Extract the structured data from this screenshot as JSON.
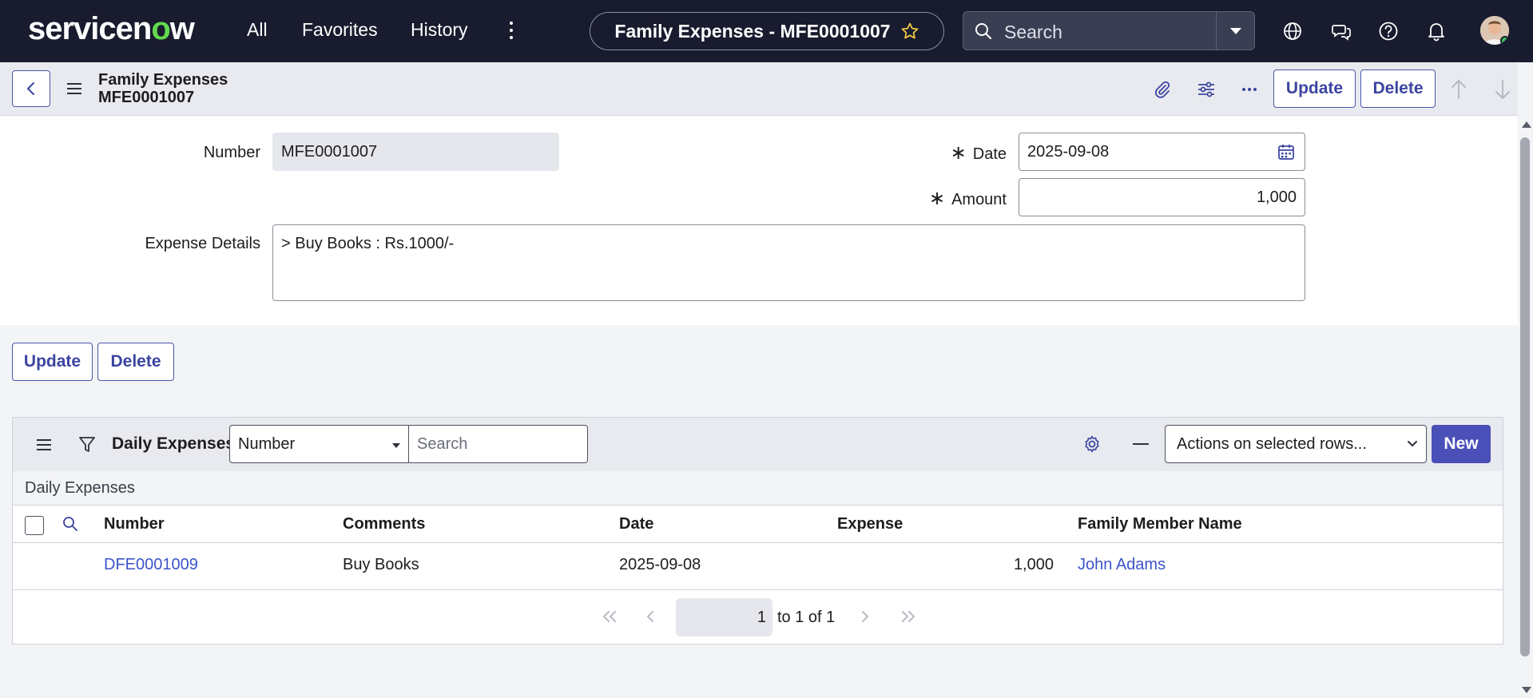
{
  "nav": {
    "logo_left": "servicen",
    "logo_o": "o",
    "logo_right": "w",
    "links": [
      "All",
      "Favorites",
      "History"
    ],
    "record_title": "Family Expenses - MFE0001007",
    "search_placeholder": "Search"
  },
  "header": {
    "title_line1": "Family Expenses",
    "title_line2": "MFE0001007",
    "update_label": "Update",
    "delete_label": "Delete"
  },
  "form": {
    "number_label": "Number",
    "number_value": "MFE0001007",
    "date_label": "Date",
    "date_value": "2025-09-08",
    "amount_label": "Amount",
    "amount_value": "1,000",
    "details_label": "Expense Details",
    "details_value": "> Buy Books : Rs.1000/-",
    "required_mark": "∗"
  },
  "form_buttons": {
    "update_label": "Update",
    "delete_label": "Delete"
  },
  "related_list": {
    "title": "Daily Expenses",
    "search_field": "Number",
    "search_placeholder": "Search",
    "actions_label": "Actions on selected rows...",
    "new_label": "New",
    "subtitle": "Daily Expenses",
    "columns": [
      "Number",
      "Comments",
      "Date",
      "Expense",
      "Family Member Name"
    ],
    "rows": [
      {
        "number": "DFE0001009",
        "comments": "Buy Books",
        "date": "2025-09-08",
        "expense": "1,000",
        "member": "John Adams"
      }
    ],
    "pager": {
      "page": "1",
      "range_text": "to 1 of 1"
    }
  },
  "colors": {
    "nav_bg": "#191c2e",
    "accent": "#4b4fb8",
    "link": "#3b54c9",
    "logo_green": "#62d84e"
  }
}
